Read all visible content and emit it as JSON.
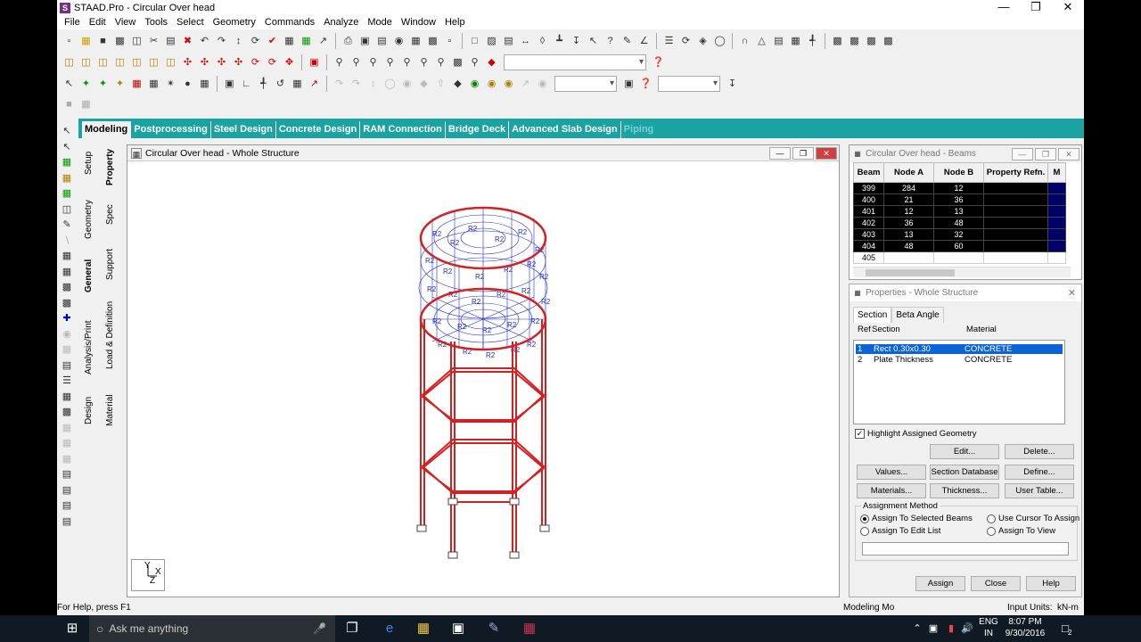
{
  "window": {
    "title": "STAAD.Pro - Circular Over head"
  },
  "menu": [
    "File",
    "Edit",
    "View",
    "Tools",
    "Select",
    "Geometry",
    "Commands",
    "Analyze",
    "Mode",
    "Window",
    "Help"
  ],
  "mode_tabs": [
    {
      "label": "Modeling",
      "state": "active"
    },
    {
      "label": "Postprocessing",
      "state": "normal"
    },
    {
      "label": "Steel Design",
      "state": "normal"
    },
    {
      "label": "Concrete Design",
      "state": "normal"
    },
    {
      "label": "RAM Connection",
      "state": "normal"
    },
    {
      "label": "Bridge Deck",
      "state": "normal"
    },
    {
      "label": "Advanced Slab Design",
      "state": "normal"
    },
    {
      "label": "Piping",
      "state": "disabled"
    }
  ],
  "side_tabs": {
    "setup": "Setup",
    "geometry": "Geometry",
    "general": "General",
    "analysis": "Analysis/Print",
    "design": "Design",
    "property": "Property",
    "spec": "Spec",
    "support": "Support",
    "load": "Load & Definition",
    "material": "Material"
  },
  "structure_window": {
    "title": "Circular Over head - Whole Structure",
    "axis_y": "Y",
    "axis_x": "X",
    "axis_z": "Z"
  },
  "beams_window": {
    "title": "Circular Over head - Beams",
    "columns": [
      "Beam",
      "Node A",
      "Node B",
      "Property Refn.",
      "M"
    ],
    "rows": [
      [
        "399",
        "284",
        "12"
      ],
      [
        "400",
        "21",
        "36"
      ],
      [
        "401",
        "12",
        "13"
      ],
      [
        "402",
        "36",
        "48"
      ],
      [
        "403",
        "13",
        "32"
      ],
      [
        "404",
        "48",
        "60"
      ],
      [
        "405",
        "",
        ""
      ]
    ]
  },
  "properties": {
    "title": "Properties - Whole Structure",
    "tabs": [
      "Section",
      "Beta Angle"
    ],
    "headers": {
      "ref": "Ref",
      "section": "Section",
      "material": "Material"
    },
    "rows": [
      {
        "ref": "1",
        "section": "Rect 0.30x0.30",
        "material": "CONCRETE"
      },
      {
        "ref": "2",
        "section": "Plate Thickness",
        "material": "CONCRETE"
      }
    ],
    "highlight_label": "Highlight Assigned Geometry",
    "highlight_checked": true,
    "buttons": {
      "edit": "Edit...",
      "delete": "Delete...",
      "values": "Values...",
      "section_db": "Section Database",
      "define": "Define...",
      "materials": "Materials...",
      "thickness": "Thickness...",
      "user_table": "User Table...",
      "assign": "Assign",
      "close": "Close",
      "help": "Help"
    },
    "assignment": {
      "label": "Assignment Method",
      "to_selected": "Assign To Selected Beams",
      "cursor": "Use Cursor To Assign",
      "edit_list": "Assign To Edit List",
      "to_view": "Assign To View",
      "selected": "to_selected"
    }
  },
  "status": {
    "help": "For Help, press F1",
    "mode": "Modeling Mo",
    "units_label": "Input Units:",
    "units": "kN-m"
  },
  "taskbar": {
    "search_placeholder": "Ask me anything",
    "lang1": "ENG",
    "lang2": "IN",
    "time": "8:07 PM",
    "date": "9/30/2016",
    "notif": "2"
  },
  "colors": {
    "accent_tab": "#1aa3a3",
    "frame": "#d42020",
    "mesh": "#1e2bd6"
  }
}
